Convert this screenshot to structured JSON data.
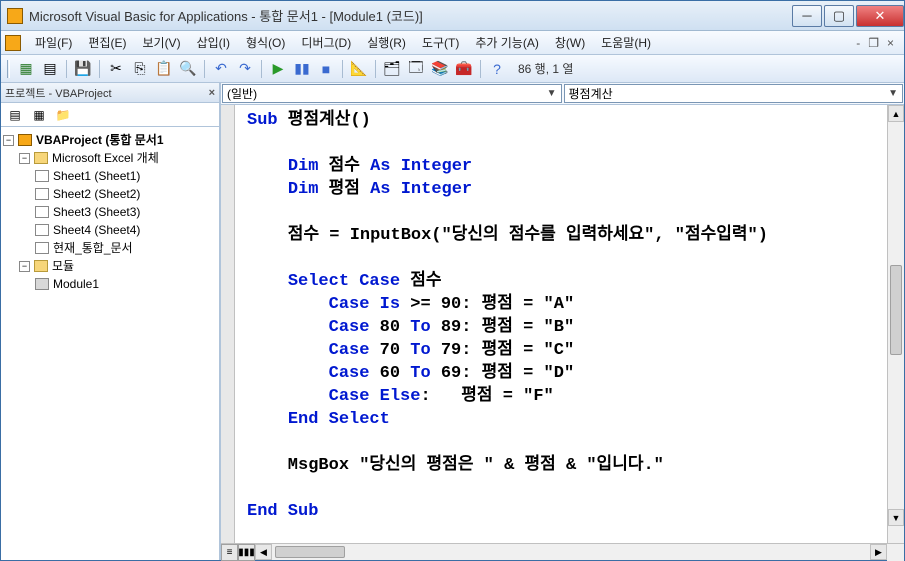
{
  "titlebar": {
    "title": "Microsoft Visual Basic for Applications - 통합 문서1 - [Module1 (코드)]"
  },
  "menu": {
    "file": "파일(F)",
    "edit": "편집(E)",
    "view": "보기(V)",
    "insert": "삽입(I)",
    "format": "형식(O)",
    "debug": "디버그(D)",
    "run": "실행(R)",
    "tools": "도구(T)",
    "addins": "추가 기능(A)",
    "window": "창(W)",
    "help": "도움말(H)"
  },
  "toolbar_status": "86 행, 1 열",
  "project_pane": {
    "title": "프로젝트 - VBAProject",
    "root": "VBAProject (통합 문서1",
    "excel_objects": "Microsoft Excel 개체",
    "sheet1": "Sheet1 (Sheet1)",
    "sheet2": "Sheet2 (Sheet2)",
    "sheet3": "Sheet3 (Sheet3)",
    "sheet4": "Sheet4 (Sheet4)",
    "thisworkbook": "현재_통합_문서",
    "modules": "모듈",
    "module1": "Module1"
  },
  "dropdowns": {
    "object": "(일반)",
    "procedure": "평점계산"
  },
  "code": {
    "l1a": "Sub",
    "l1b": " 평점계산()",
    "l2a": "Dim",
    "l2b": " 점수 ",
    "l2c": "As Integer",
    "l3a": "Dim",
    "l3b": " 평점 ",
    "l3c": "As Integer",
    "l4": "    점수 = InputBox(\"당신의 점수를 입력하세요\", \"점수입력\")",
    "l5a": "Select Case",
    "l5b": " 점수",
    "l6a": "Case Is",
    "l6b": " >= 90: 평점 = \"A\"",
    "l7a": "Case",
    "l7b": " 80 ",
    "l7c": "To",
    "l7d": " 89: 평점 = \"B\"",
    "l8a": "Case",
    "l8b": " 70 ",
    "l8c": "To",
    "l8d": " 79: 평점 = \"C\"",
    "l9a": "Case",
    "l9b": " 60 ",
    "l9c": "To",
    "l9d": " 69: 평점 = \"D\"",
    "l10a": "Case Else",
    "l10b": ":   평점 = \"F\"",
    "l11": "End Select",
    "l12": "    MsgBox \"당신의 평점은 \" & 평점 & \"입니다.\"",
    "l13": "End Sub"
  }
}
